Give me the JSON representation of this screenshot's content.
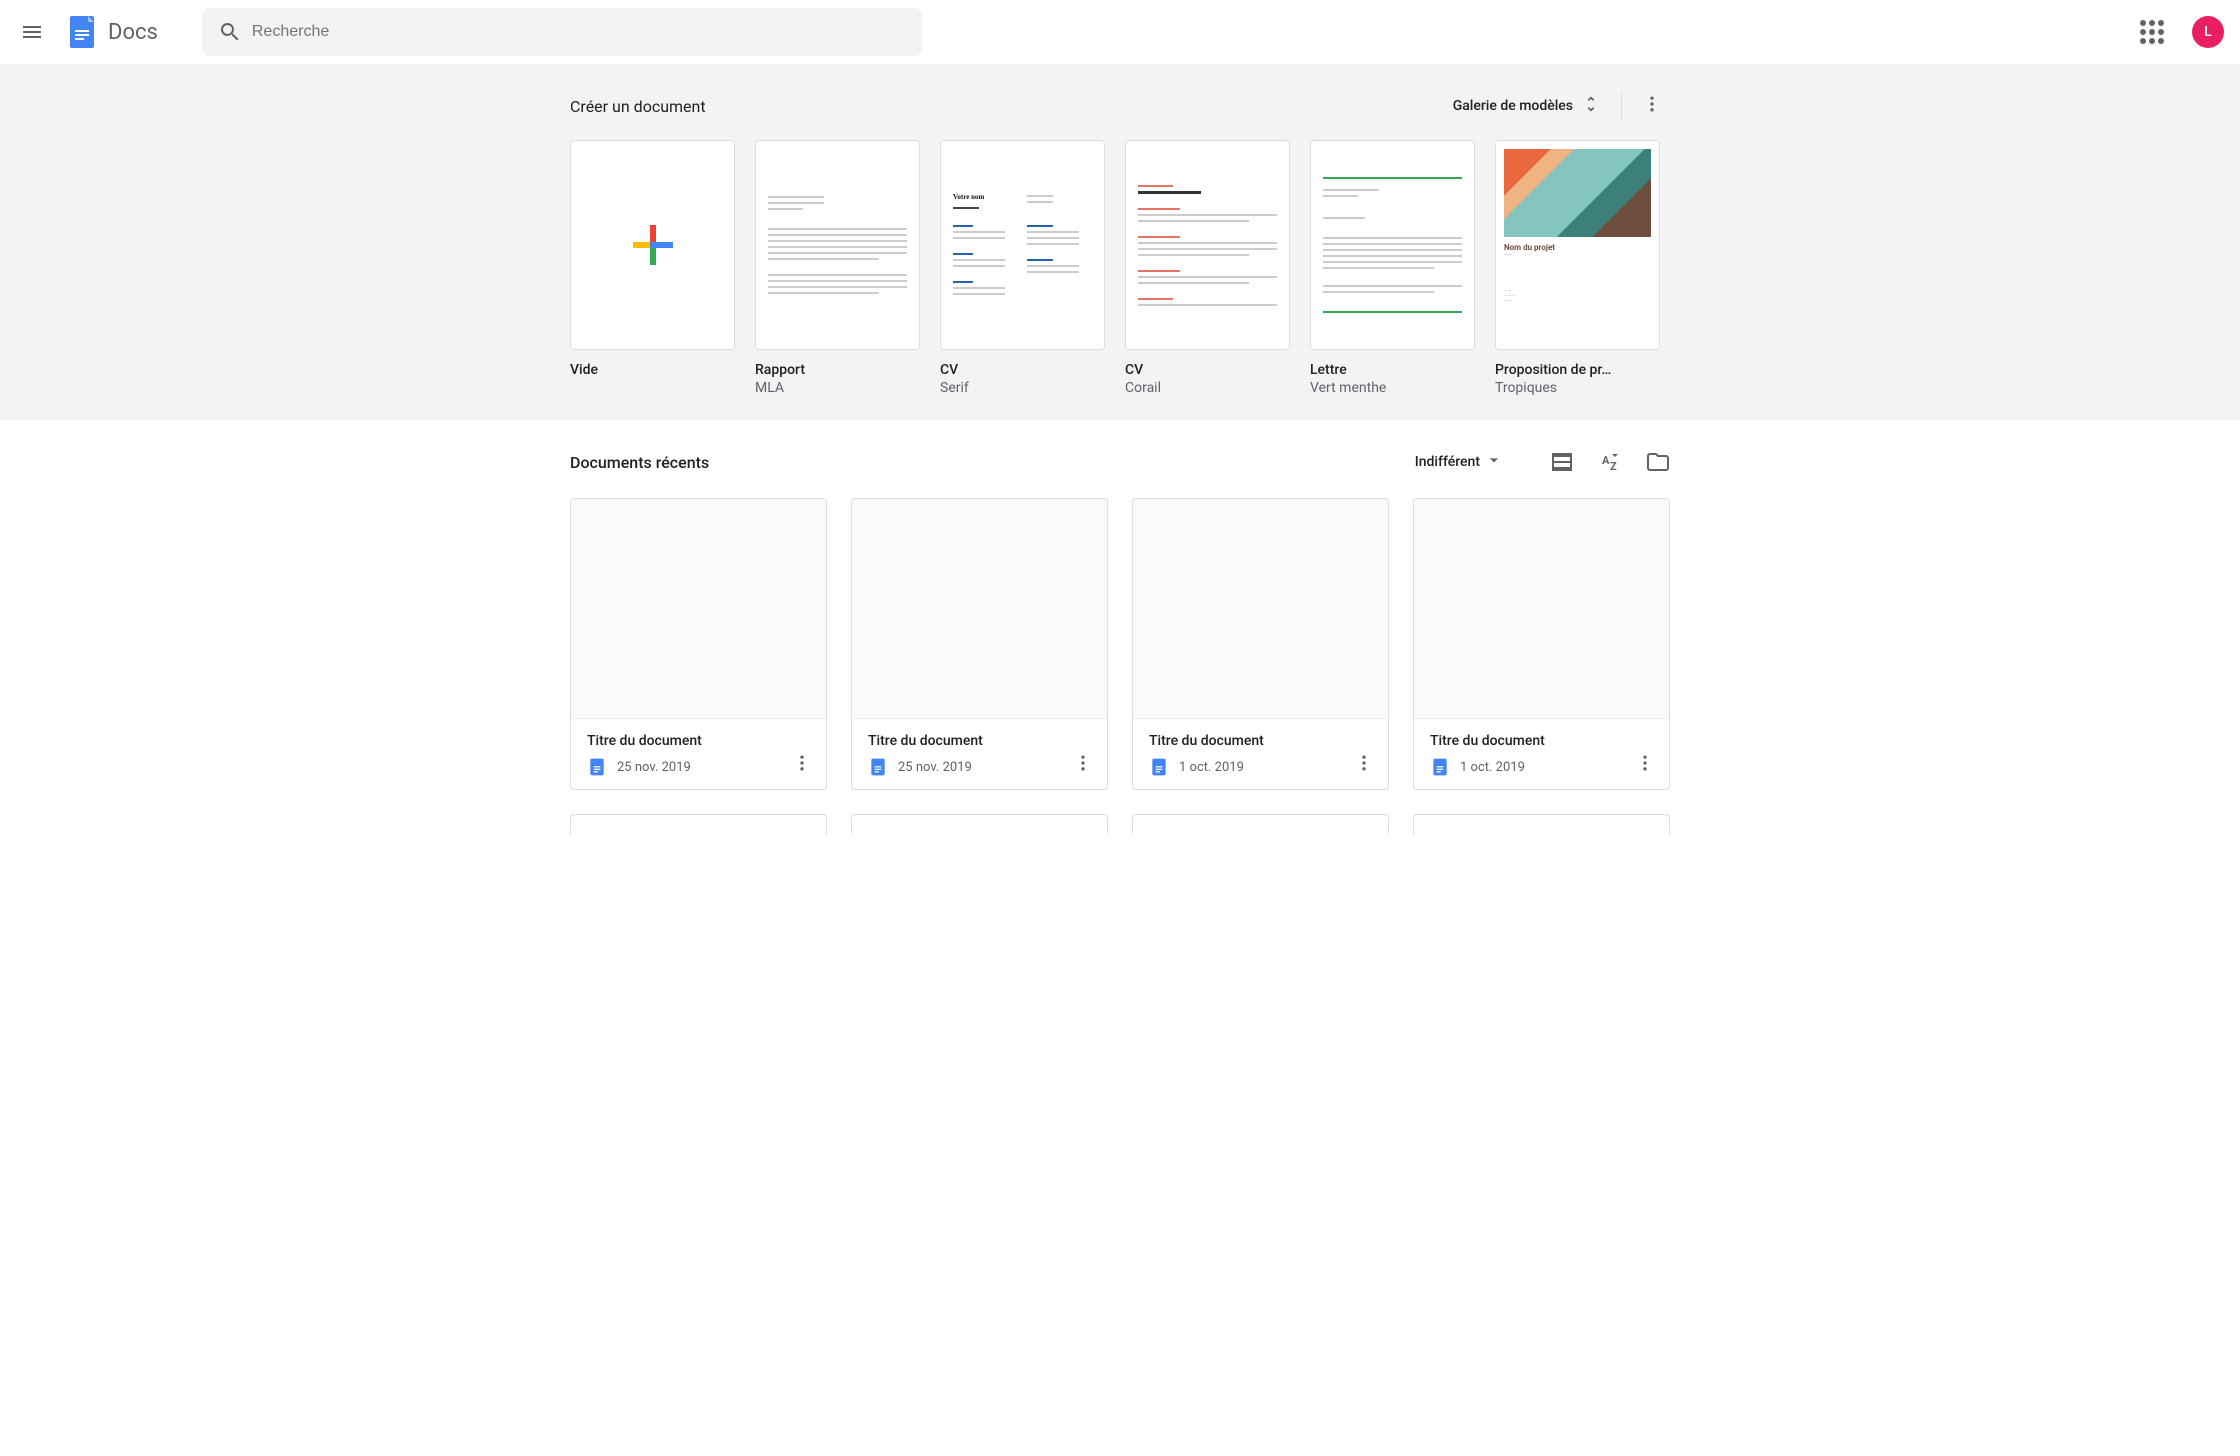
{
  "header": {
    "app_name": "Docs",
    "search_placeholder": "Recherche",
    "avatar_letter": "L"
  },
  "template_gallery": {
    "heading": "Créer un document",
    "gallery_button": "Galerie de modèles",
    "templates": [
      {
        "name": "Vide",
        "subtitle": ""
      },
      {
        "name": "Rapport",
        "subtitle": "MLA"
      },
      {
        "name": "CV",
        "subtitle": "Serif"
      },
      {
        "name": "CV",
        "subtitle": "Corail"
      },
      {
        "name": "Lettre",
        "subtitle": "Vert menthe"
      },
      {
        "name": "Proposition de pr…",
        "subtitle": "Tropiques"
      }
    ],
    "tropic_title": "Nom du projet"
  },
  "recent": {
    "heading": "Documents récents",
    "ownership_filter": "Indifférent",
    "documents": [
      {
        "title": "Titre du document",
        "date": "25 nov. 2019"
      },
      {
        "title": "Titre du document",
        "date": "25 nov. 2019"
      },
      {
        "title": "Titre du document",
        "date": "1 oct. 2019"
      },
      {
        "title": "Titre du document",
        "date": "1 oct. 2019"
      }
    ]
  }
}
